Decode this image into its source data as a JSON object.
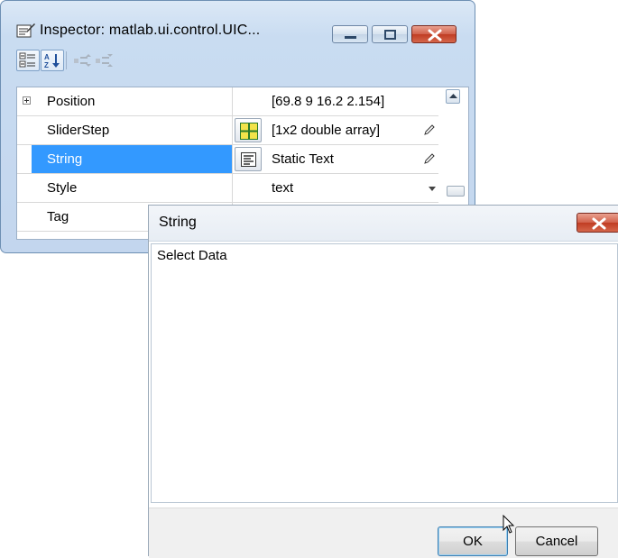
{
  "inspector": {
    "title": "Inspector:  matlab.ui.control.UIC...",
    "toolbar": {
      "categorized_icon": "categorized-view-icon",
      "sort_icon": "sort-alphabetical-icon",
      "expand_icon": "expand-all-icon",
      "collapse_icon": "collapse-all-icon"
    },
    "properties": [
      {
        "name": "Position",
        "value": "[69.8 9 16.2 2.154]",
        "expandable": true
      },
      {
        "name": "SliderStep",
        "value": "[1x2  double array]",
        "editor_icon": "array-editor-icon"
      },
      {
        "name": "String",
        "value": "Static Text",
        "editor_icon": "text-editor-icon",
        "selected": true
      },
      {
        "name": "Style",
        "value": "text",
        "control": "dropdown"
      },
      {
        "name": "Tag",
        "value": ""
      }
    ],
    "colors": {
      "selection": "#3399ff",
      "frame": "#c9dcf1",
      "close_button": "#c7432a"
    }
  },
  "dialog": {
    "title": "String",
    "text": "Select Data",
    "ok_label": "OK",
    "cancel_label": "Cancel"
  }
}
